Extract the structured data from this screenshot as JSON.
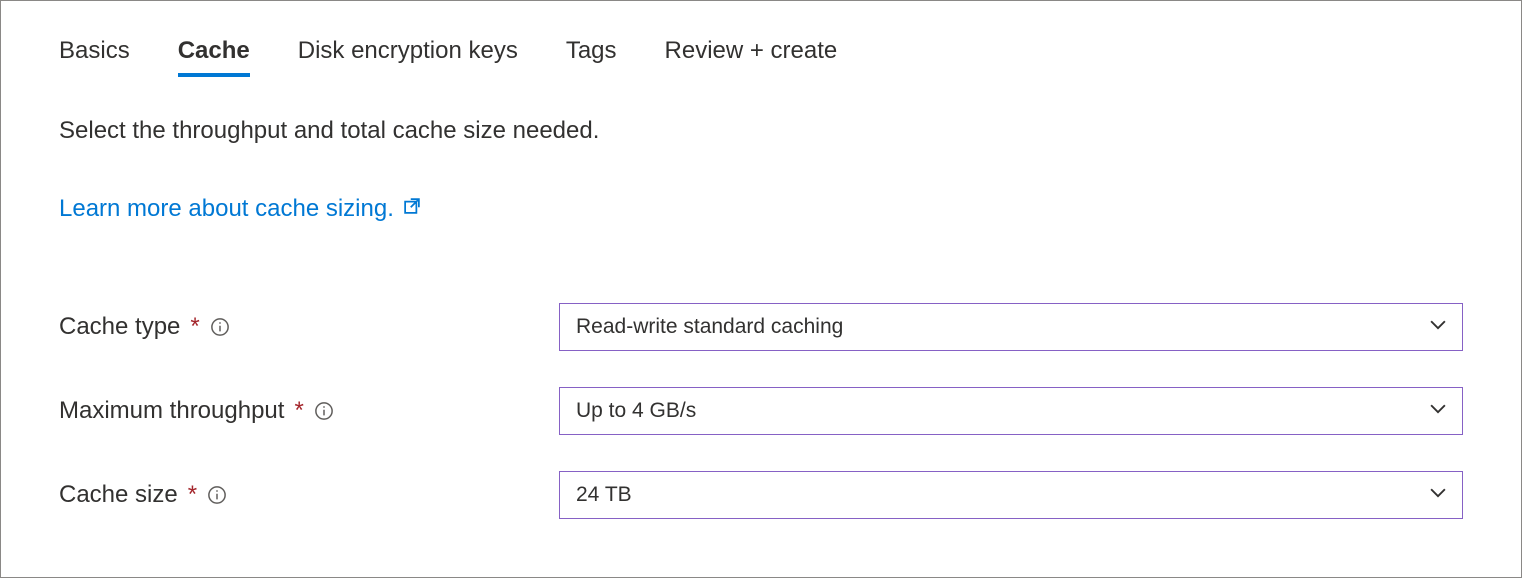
{
  "tabs": {
    "basics": "Basics",
    "cache": "Cache",
    "disk_encryption": "Disk encryption keys",
    "tags": "Tags",
    "review": "Review + create"
  },
  "description": "Select the throughput and total cache size needed.",
  "learn_more": "Learn more about cache sizing.",
  "fields": {
    "cache_type": {
      "label": "Cache type",
      "value": "Read-write standard caching"
    },
    "max_throughput": {
      "label": "Maximum throughput",
      "value": "Up to 4 GB/s"
    },
    "cache_size": {
      "label": "Cache size",
      "value": "24 TB"
    }
  },
  "required_marker": "*"
}
